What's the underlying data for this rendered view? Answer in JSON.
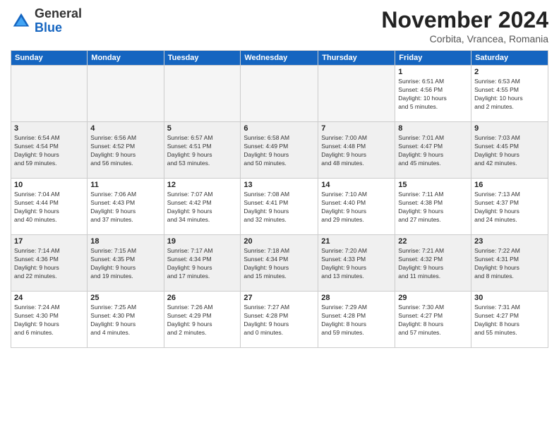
{
  "logo": {
    "general": "General",
    "blue": "Blue"
  },
  "title": "November 2024",
  "location": "Corbita, Vrancea, Romania",
  "days_of_week": [
    "Sunday",
    "Monday",
    "Tuesday",
    "Wednesday",
    "Thursday",
    "Friday",
    "Saturday"
  ],
  "weeks": [
    [
      {
        "day": "",
        "info": "",
        "empty": true
      },
      {
        "day": "",
        "info": "",
        "empty": true
      },
      {
        "day": "",
        "info": "",
        "empty": true
      },
      {
        "day": "",
        "info": "",
        "empty": true
      },
      {
        "day": "",
        "info": "",
        "empty": true
      },
      {
        "day": "1",
        "info": "Sunrise: 6:51 AM\nSunset: 4:56 PM\nDaylight: 10 hours\nand 5 minutes.",
        "empty": false
      },
      {
        "day": "2",
        "info": "Sunrise: 6:53 AM\nSunset: 4:55 PM\nDaylight: 10 hours\nand 2 minutes.",
        "empty": false
      }
    ],
    [
      {
        "day": "3",
        "info": "Sunrise: 6:54 AM\nSunset: 4:54 PM\nDaylight: 9 hours\nand 59 minutes.",
        "empty": false
      },
      {
        "day": "4",
        "info": "Sunrise: 6:56 AM\nSunset: 4:52 PM\nDaylight: 9 hours\nand 56 minutes.",
        "empty": false
      },
      {
        "day": "5",
        "info": "Sunrise: 6:57 AM\nSunset: 4:51 PM\nDaylight: 9 hours\nand 53 minutes.",
        "empty": false
      },
      {
        "day": "6",
        "info": "Sunrise: 6:58 AM\nSunset: 4:49 PM\nDaylight: 9 hours\nand 50 minutes.",
        "empty": false
      },
      {
        "day": "7",
        "info": "Sunrise: 7:00 AM\nSunset: 4:48 PM\nDaylight: 9 hours\nand 48 minutes.",
        "empty": false
      },
      {
        "day": "8",
        "info": "Sunrise: 7:01 AM\nSunset: 4:47 PM\nDaylight: 9 hours\nand 45 minutes.",
        "empty": false
      },
      {
        "day": "9",
        "info": "Sunrise: 7:03 AM\nSunset: 4:45 PM\nDaylight: 9 hours\nand 42 minutes.",
        "empty": false
      }
    ],
    [
      {
        "day": "10",
        "info": "Sunrise: 7:04 AM\nSunset: 4:44 PM\nDaylight: 9 hours\nand 40 minutes.",
        "empty": false
      },
      {
        "day": "11",
        "info": "Sunrise: 7:06 AM\nSunset: 4:43 PM\nDaylight: 9 hours\nand 37 minutes.",
        "empty": false
      },
      {
        "day": "12",
        "info": "Sunrise: 7:07 AM\nSunset: 4:42 PM\nDaylight: 9 hours\nand 34 minutes.",
        "empty": false
      },
      {
        "day": "13",
        "info": "Sunrise: 7:08 AM\nSunset: 4:41 PM\nDaylight: 9 hours\nand 32 minutes.",
        "empty": false
      },
      {
        "day": "14",
        "info": "Sunrise: 7:10 AM\nSunset: 4:40 PM\nDaylight: 9 hours\nand 29 minutes.",
        "empty": false
      },
      {
        "day": "15",
        "info": "Sunrise: 7:11 AM\nSunset: 4:38 PM\nDaylight: 9 hours\nand 27 minutes.",
        "empty": false
      },
      {
        "day": "16",
        "info": "Sunrise: 7:13 AM\nSunset: 4:37 PM\nDaylight: 9 hours\nand 24 minutes.",
        "empty": false
      }
    ],
    [
      {
        "day": "17",
        "info": "Sunrise: 7:14 AM\nSunset: 4:36 PM\nDaylight: 9 hours\nand 22 minutes.",
        "empty": false
      },
      {
        "day": "18",
        "info": "Sunrise: 7:15 AM\nSunset: 4:35 PM\nDaylight: 9 hours\nand 19 minutes.",
        "empty": false
      },
      {
        "day": "19",
        "info": "Sunrise: 7:17 AM\nSunset: 4:34 PM\nDaylight: 9 hours\nand 17 minutes.",
        "empty": false
      },
      {
        "day": "20",
        "info": "Sunrise: 7:18 AM\nSunset: 4:34 PM\nDaylight: 9 hours\nand 15 minutes.",
        "empty": false
      },
      {
        "day": "21",
        "info": "Sunrise: 7:20 AM\nSunset: 4:33 PM\nDaylight: 9 hours\nand 13 minutes.",
        "empty": false
      },
      {
        "day": "22",
        "info": "Sunrise: 7:21 AM\nSunset: 4:32 PM\nDaylight: 9 hours\nand 11 minutes.",
        "empty": false
      },
      {
        "day": "23",
        "info": "Sunrise: 7:22 AM\nSunset: 4:31 PM\nDaylight: 9 hours\nand 8 minutes.",
        "empty": false
      }
    ],
    [
      {
        "day": "24",
        "info": "Sunrise: 7:24 AM\nSunset: 4:30 PM\nDaylight: 9 hours\nand 6 minutes.",
        "empty": false
      },
      {
        "day": "25",
        "info": "Sunrise: 7:25 AM\nSunset: 4:30 PM\nDaylight: 9 hours\nand 4 minutes.",
        "empty": false
      },
      {
        "day": "26",
        "info": "Sunrise: 7:26 AM\nSunset: 4:29 PM\nDaylight: 9 hours\nand 2 minutes.",
        "empty": false
      },
      {
        "day": "27",
        "info": "Sunrise: 7:27 AM\nSunset: 4:28 PM\nDaylight: 9 hours\nand 0 minutes.",
        "empty": false
      },
      {
        "day": "28",
        "info": "Sunrise: 7:29 AM\nSunset: 4:28 PM\nDaylight: 8 hours\nand 59 minutes.",
        "empty": false
      },
      {
        "day": "29",
        "info": "Sunrise: 7:30 AM\nSunset: 4:27 PM\nDaylight: 8 hours\nand 57 minutes.",
        "empty": false
      },
      {
        "day": "30",
        "info": "Sunrise: 7:31 AM\nSunset: 4:27 PM\nDaylight: 8 hours\nand 55 minutes.",
        "empty": false
      }
    ]
  ]
}
